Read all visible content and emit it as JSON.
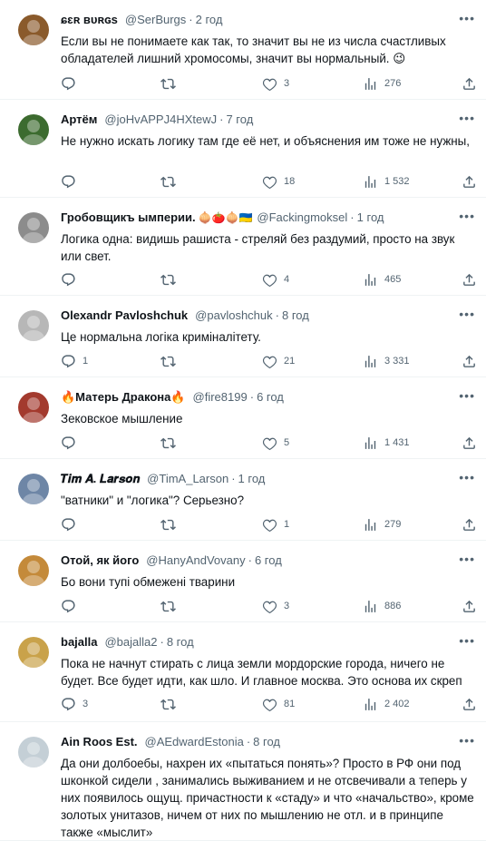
{
  "tweets": [
    {
      "name": "ɕɛʀ ʙᴜʀɢs",
      "emoji": "",
      "handle": "@SerBurgs",
      "time": "2 год",
      "text": "Если вы не понимаете как так, то значит вы не из числа счастливых обладателей лишний хромосомы, значит вы нормальный. 😉",
      "replies": "",
      "retweets": "",
      "likes": "3",
      "views": "276",
      "avatar_color": "#8a5a2b"
    },
    {
      "name": "Артём",
      "emoji": "",
      "handle": "@joHvAPPJ4HXtewJ",
      "time": "7 год",
      "text": "Не нужно искать логику там где её нет, и объяснения им тоже не нужны,",
      "replies": "",
      "retweets": "",
      "likes": "18",
      "views": "1 532",
      "avatar_color": "#3c6b2f"
    },
    {
      "name": "Гробовщикъ ымперии.",
      "emoji": "🧅🍅🧅🇺🇦",
      "handle": "@Fackingmoksel",
      "time": "1 год",
      "text": "Логика одна: видишь рашиста - стреляй без раздумий, просто на звук или свет.",
      "replies": "",
      "retweets": "",
      "likes": "4",
      "views": "465",
      "avatar_color": "#8c8c8c"
    },
    {
      "name": "Olexandr Pavloshchuk",
      "emoji": "",
      "handle": "@pavloshchuk",
      "time": "8 год",
      "text": "Це нормальна логіка криміналітету.",
      "replies": "1",
      "retweets": "",
      "likes": "21",
      "views": "3 331",
      "avatar_color": "#b7b7b7"
    },
    {
      "name": "🔥Матерь Дракона🔥",
      "emoji": "",
      "handle": "@fire8199",
      "time": "6 год",
      "text": "Зековское мышление",
      "replies": "",
      "retweets": "",
      "likes": "5",
      "views": "1 431",
      "avatar_color": "#a33a2e"
    },
    {
      "name": "𝑻𝒊𝒎 𝑨. 𝑳𝒂𝒓𝒔𝒐𝒏",
      "emoji": "",
      "handle": "@TimA_Larson",
      "time": "1 год",
      "text": "\"ватники\" и \"логика\"? Серьезно?",
      "replies": "",
      "retweets": "",
      "likes": "1",
      "views": "279",
      "avatar_color": "#6e86a6"
    },
    {
      "name": "Отой, як його",
      "emoji": "",
      "handle": "@HanyAndVovany",
      "time": "6 год",
      "text": "Бо вони тупі обмежені тварини",
      "replies": "",
      "retweets": "",
      "likes": "3",
      "views": "886",
      "avatar_color": "#c48a3a"
    },
    {
      "name": "bajalla",
      "emoji": "",
      "handle": "@bajalla2",
      "time": "8 год",
      "text": "Пока не начнут стирать с лица земли мордорские города, ничего не будет. Все будет идти, как шло. И главное москва. Это основа их скреп",
      "replies": "3",
      "retweets": "",
      "likes": "81",
      "views": "2 402",
      "avatar_color": "#c9a24a"
    },
    {
      "name": "Ain Roos Est.",
      "emoji": "",
      "handle": "@AEdwardEstonia",
      "time": "8 год",
      "text": "Да они долбоебы, нахрен их «пытаться понять»? Просто в РФ они под шконкой сидели , занимались выживанием и не отсвечивали а теперь у них появилось ощущ. причастности к «стаду» и что «начальство», кроме золотых унитазов, ничем от них по мышлению не отл. и в принципе также «мыслит»",
      "replies": "",
      "retweets": "",
      "likes": "",
      "views": "",
      "avatar_color": "#c4cfd6"
    }
  ],
  "icons": {
    "reply": "reply-icon",
    "retweet": "retweet-icon",
    "like": "heart-icon",
    "views": "views-icon",
    "share": "share-icon",
    "more": "more-icon"
  },
  "more_glyph": "•••"
}
